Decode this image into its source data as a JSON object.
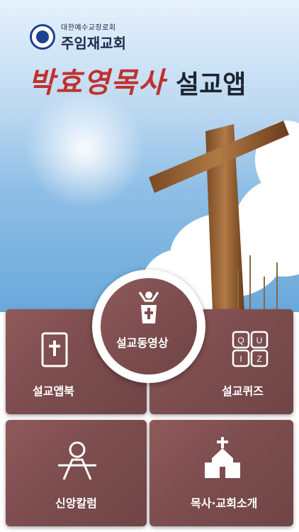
{
  "header": {
    "denomination": "대한예수교장로회",
    "church_name": "주임재교회"
  },
  "title": {
    "red": "박효영목사",
    "dark": "설교앱"
  },
  "menu": {
    "center": "설교동영상",
    "top_left": "설교앱북",
    "top_right": "설교퀴즈",
    "bottom_left": "신앙칼럼",
    "bottom_right": "목사·교회소개"
  },
  "quiz_letters": [
    "Q",
    "U",
    "I",
    "Z"
  ],
  "colors": {
    "tile": "#7d4d4f",
    "accent_red": "#c0312e",
    "navy": "#1f3f90"
  }
}
